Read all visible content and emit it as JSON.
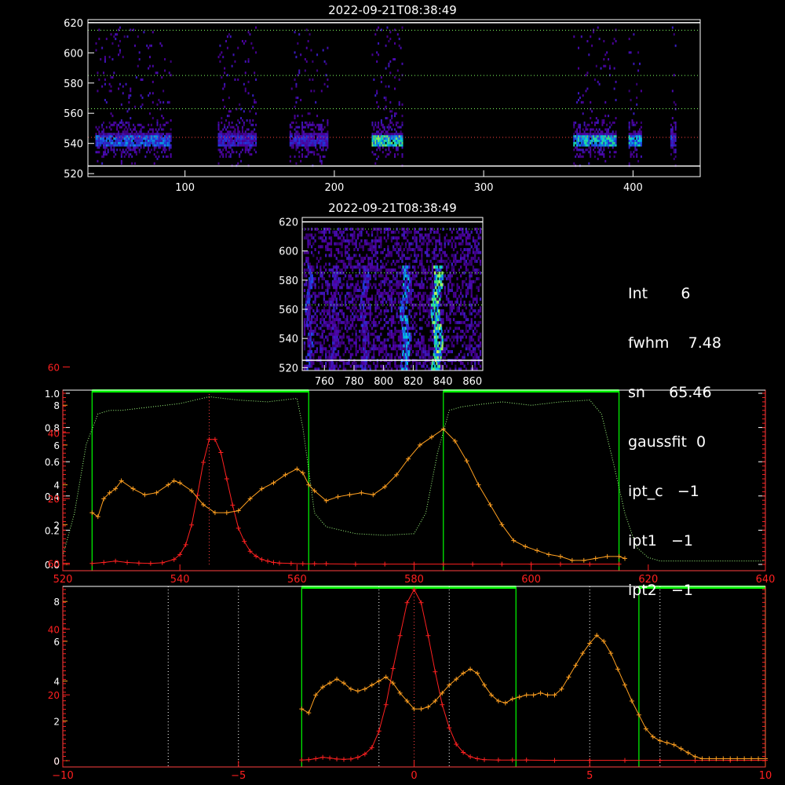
{
  "chart_data": [
    {
      "type": "heatmap",
      "title": "2022-09-21T08:38:49",
      "xlim": [
        35,
        445
      ],
      "ylim": [
        518,
        622
      ],
      "x_ticks": [
        "100",
        "200",
        "300",
        "400"
      ],
      "y_ticks": [
        "520",
        "540",
        "560",
        "580",
        "600",
        "620"
      ],
      "hlines_white": [
        525,
        620
      ],
      "hlines_green_dotted": [
        563,
        585,
        615
      ],
      "hlines_red_dotted": [
        544
      ],
      "emission_columns": [
        {
          "x0": 40,
          "x1": 90,
          "peak": 0.6
        },
        {
          "x0": 122,
          "x1": 147,
          "peak": 0.45
        },
        {
          "x0": 170,
          "x1": 195,
          "peak": 0.45
        },
        {
          "x0": 225,
          "x1": 245,
          "peak": 0.9
        },
        {
          "x0": 360,
          "x1": 388,
          "peak": 0.8
        },
        {
          "x0": 397,
          "x1": 405,
          "peak": 0.75
        },
        {
          "x0": 425,
          "x1": 428,
          "peak": 0.5
        }
      ]
    },
    {
      "type": "heatmap",
      "title": "2022-09-21T08:38:49",
      "xlim": [
        745,
        867
      ],
      "ylim": [
        518,
        623
      ],
      "x_ticks": [
        "760",
        "780",
        "800",
        "820",
        "840",
        "860"
      ],
      "y_ticks": [
        "520",
        "540",
        "560",
        "580",
        "600",
        "620"
      ],
      "hlines_white": [
        525,
        620
      ],
      "hlines_green_dotted": [
        563,
        585,
        615
      ],
      "streaks": [
        {
          "x": 748,
          "w": 3,
          "peak": 0.5
        },
        {
          "x": 764,
          "w": 4,
          "peak": 0.4
        },
        {
          "x": 785,
          "w": 4,
          "peak": 0.45
        },
        {
          "x": 812,
          "w": 5,
          "peak": 0.7
        },
        {
          "x": 833,
          "w": 6,
          "peak": 1.0
        }
      ]
    },
    {
      "type": "line",
      "xlim": [
        520,
        640
      ],
      "x_ticks": [
        "520",
        "540",
        "560",
        "580",
        "600",
        "620",
        "640"
      ],
      "left_axis_white": [
        "0.0",
        "0.2",
        "0.4",
        "0.6",
        "0.8",
        "1.0"
      ],
      "left_axis_red": [
        "0",
        "20",
        "40",
        "60"
      ],
      "left_axis_yellow": [
        "0",
        "2",
        "4",
        "6",
        "8"
      ],
      "green_bands": [
        [
          525,
          562
        ],
        [
          585,
          615
        ]
      ],
      "red_dotted_x": 545,
      "series": [
        {
          "color": "#ff2020",
          "x": [
            525,
            527,
            529,
            531,
            533,
            535,
            537,
            539,
            540,
            541,
            542,
            543,
            544,
            545,
            546,
            547,
            548,
            549,
            550,
            551,
            552,
            553,
            554,
            555,
            556,
            557,
            559,
            561,
            563,
            565,
            570,
            575,
            580,
            585,
            590,
            595,
            600,
            605,
            610,
            615
          ],
          "y": [
            0.3,
            0.6,
            1.0,
            0.6,
            0.4,
            0.3,
            0.5,
            1.5,
            3,
            6,
            12,
            21,
            31,
            38,
            38,
            34,
            26,
            18,
            11,
            7,
            4,
            2.5,
            1.5,
            1,
            0.6,
            0.4,
            0.3,
            0.2,
            0.2,
            0.2,
            0.1,
            0.1,
            0.1,
            0.1,
            0.1,
            0.1,
            0.1,
            0.1,
            0.1,
            0.1
          ]
        },
        {
          "color": "#ffa020",
          "x": [
            525,
            526,
            527,
            528,
            529,
            530,
            532,
            534,
            536,
            538,
            539,
            540,
            542,
            544,
            546,
            548,
            550,
            552,
            554,
            556,
            558,
            560,
            561,
            562,
            563,
            565,
            567,
            569,
            571,
            573,
            575,
            577,
            579,
            581,
            583,
            585,
            587,
            589,
            591,
            593,
            595,
            597,
            599,
            601,
            603,
            605,
            607,
            609,
            611,
            613,
            615,
            616
          ],
          "y": [
            2.6,
            2.4,
            3.3,
            3.6,
            3.8,
            4.2,
            3.8,
            3.5,
            3.6,
            4.0,
            4.2,
            4.1,
            3.7,
            3.0,
            2.6,
            2.6,
            2.7,
            3.3,
            3.8,
            4.1,
            4.5,
            4.8,
            4.6,
            4.0,
            3.7,
            3.2,
            3.4,
            3.5,
            3.6,
            3.5,
            3.9,
            4.5,
            5.3,
            6.0,
            6.4,
            6.8,
            6.2,
            5.2,
            4.0,
            3.0,
            2.0,
            1.2,
            0.9,
            0.7,
            0.5,
            0.4,
            0.2,
            0.2,
            0.3,
            0.4,
            0.4,
            0.3
          ]
        },
        {
          "color": "#a0ff80",
          "dotted": true,
          "x": [
            520,
            522,
            524,
            526,
            528,
            530,
            535,
            540,
            545,
            550,
            555,
            560,
            561,
            562,
            563,
            565,
            570,
            575,
            580,
            582,
            584,
            586,
            588,
            590,
            595,
            600,
            605,
            610,
            612,
            614,
            616,
            618,
            620,
            622,
            625,
            630,
            635,
            640
          ],
          "y": [
            0.05,
            0.3,
            0.7,
            0.88,
            0.9,
            0.9,
            0.92,
            0.94,
            0.98,
            0.96,
            0.95,
            0.97,
            0.8,
            0.55,
            0.3,
            0.22,
            0.18,
            0.17,
            0.18,
            0.3,
            0.65,
            0.9,
            0.92,
            0.93,
            0.95,
            0.93,
            0.95,
            0.96,
            0.88,
            0.6,
            0.3,
            0.1,
            0.04,
            0.02,
            0.02,
            0.02,
            0.02,
            0.02
          ]
        }
      ]
    },
    {
      "type": "line",
      "xlim": [
        -10,
        10
      ],
      "x_ticks": [
        "−10",
        "−5",
        "0",
        "5",
        "10"
      ],
      "left_axis_red": [
        "0",
        "20",
        "40",
        "60"
      ],
      "left_axis_yellow": [
        "0",
        "2",
        "4",
        "6",
        "8"
      ],
      "green_bands": [
        [
          -3.2,
          2.9
        ],
        [
          6.4,
          10
        ]
      ],
      "white_dotted_x": [
        -7,
        -5,
        -1,
        1,
        5,
        7
      ],
      "red_dotted_x": 0,
      "series": [
        {
          "color": "#ff2020",
          "x": [
            -3.2,
            -3.0,
            -2.8,
            -2.6,
            -2.4,
            -2.2,
            -2.0,
            -1.8,
            -1.6,
            -1.4,
            -1.2,
            -1.0,
            -0.8,
            -0.6,
            -0.4,
            -0.2,
            0,
            0.2,
            0.4,
            0.6,
            0.8,
            1.0,
            1.2,
            1.4,
            1.6,
            1.8,
            2.0,
            2.4,
            2.8,
            3.2,
            4,
            5,
            6,
            7,
            8,
            9,
            10
          ],
          "y": [
            0.2,
            0.3,
            0.6,
            1,
            0.8,
            0.5,
            0.4,
            0.5,
            1,
            2,
            4,
            9,
            17,
            28,
            38,
            48,
            52,
            48,
            38,
            27,
            17,
            10,
            5,
            2.5,
            1.2,
            0.6,
            0.3,
            0.2,
            0.2,
            0.2,
            0.1,
            0.1,
            0.1,
            0.1,
            0.1,
            0.1,
            0.1
          ]
        },
        {
          "color": "#ffa020",
          "x": [
            -3.2,
            -3.0,
            -2.8,
            -2.6,
            -2.4,
            -2.2,
            -2.0,
            -1.8,
            -1.6,
            -1.4,
            -1.2,
            -1.0,
            -0.8,
            -0.6,
            -0.4,
            -0.2,
            0,
            0.2,
            0.4,
            0.6,
            0.8,
            1.0,
            1.2,
            1.4,
            1.6,
            1.8,
            2.0,
            2.2,
            2.4,
            2.6,
            2.8,
            3.0,
            3.2,
            3.4,
            3.6,
            3.8,
            4.0,
            4.2,
            4.4,
            4.6,
            4.8,
            5.0,
            5.2,
            5.4,
            5.6,
            5.8,
            6.0,
            6.2,
            6.4,
            6.6,
            6.8,
            7.0,
            7.2,
            7.4,
            7.6,
            7.8,
            8.0,
            8.2,
            8.4,
            8.6,
            8.8,
            9.0,
            9.2,
            9.4,
            9.6,
            9.8,
            10
          ],
          "y": [
            2.6,
            2.4,
            3.3,
            3.7,
            3.9,
            4.1,
            3.9,
            3.6,
            3.5,
            3.6,
            3.8,
            4.0,
            4.2,
            3.9,
            3.4,
            3.0,
            2.6,
            2.6,
            2.7,
            3.0,
            3.4,
            3.8,
            4.1,
            4.4,
            4.6,
            4.4,
            3.8,
            3.3,
            3.0,
            2.9,
            3.1,
            3.2,
            3.3,
            3.3,
            3.4,
            3.3,
            3.3,
            3.6,
            4.2,
            4.8,
            5.4,
            5.9,
            6.3,
            6.0,
            5.4,
            4.6,
            3.8,
            3.0,
            2.3,
            1.6,
            1.2,
            1.0,
            0.9,
            0.8,
            0.6,
            0.4,
            0.2,
            0.1,
            0.1,
            0.1,
            0.1,
            0.1,
            0.1,
            0.1,
            0.1,
            0.1,
            0.1
          ]
        }
      ]
    }
  ],
  "info_panel": [
    {
      "key": "Int",
      "value": "6",
      "text": "Int       6"
    },
    {
      "key": "fwhm",
      "value": "7.48",
      "text": "fwhm    7.48"
    },
    {
      "key": "sn",
      "value": "65.46",
      "text": "sn     65.46"
    },
    {
      "key": "gaussfit",
      "value": "0",
      "text": "gaussfit  0"
    },
    {
      "key": "ipt_c",
      "value": "−1",
      "text": "ipt_c   −1"
    },
    {
      "key": "ipt1",
      "value": "−1",
      "text": "ipt1   −1"
    },
    {
      "key": "ipt2",
      "value": "−1",
      "text": "ipt2   −1"
    }
  ],
  "colors": {
    "axis": "#ffffff",
    "red": "#ff2020",
    "orange": "#ffa020",
    "green": "#00ff00",
    "lightgreen": "#a0ff80"
  }
}
